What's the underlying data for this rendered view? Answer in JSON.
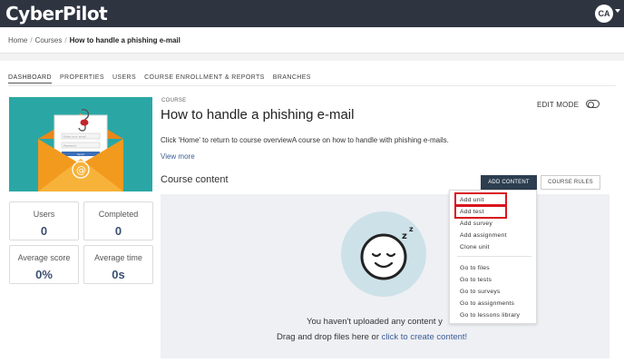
{
  "app": {
    "logo_text": "CyberPilot",
    "user_initials": "CA"
  },
  "breadcrumb": {
    "home": "Home",
    "courses": "Courses",
    "current": "How to handle a phishing e-mail",
    "separator": "/"
  },
  "tabs": [
    "DASHBOARD",
    "PROPERTIES",
    "USERS",
    "COURSE ENROLLMENT & REPORTS",
    "BRANCHES"
  ],
  "stats": {
    "users": {
      "label": "Users",
      "value": "0"
    },
    "completed": {
      "label": "Completed",
      "value": "0"
    },
    "avg_score": {
      "label": "Average score",
      "value": "0%"
    },
    "avg_time": {
      "label": "Average time",
      "value": "0s"
    }
  },
  "course": {
    "kicker": "COURSE",
    "title": "How to handle a phishing e-mail",
    "description": "Click 'Home' to return to course overviewA course on how to handle with phishing e-mails.",
    "view_more": "View more",
    "edit_mode": "EDIT MODE"
  },
  "content": {
    "title": "Course content",
    "add_button": "ADD CONTENT",
    "rules_button": "COURSE RULES",
    "empty_message": "You haven't uploaded any content y",
    "drag_prefix": "Drag and drop files here or ",
    "drag_link": "click to create content!",
    "sleep_glyph": "z"
  },
  "dropdown": {
    "items": [
      "Add unit",
      "Add test",
      "Add survey",
      "Add assignment",
      "Clone unit"
    ],
    "links": [
      "Go to files",
      "Go to tests",
      "Go to surveys",
      "Go to assignments",
      "Go to lessons library"
    ]
  },
  "thumbnail": {
    "email_field": "Enter your email",
    "password_field": "Password",
    "button": "Send"
  },
  "colors": {
    "topbar": "#2f3441",
    "teal": "#2aa7a5",
    "envelope": "#f29a1d",
    "highlight": "#d9151d",
    "primary_button": "#2c3e50"
  }
}
